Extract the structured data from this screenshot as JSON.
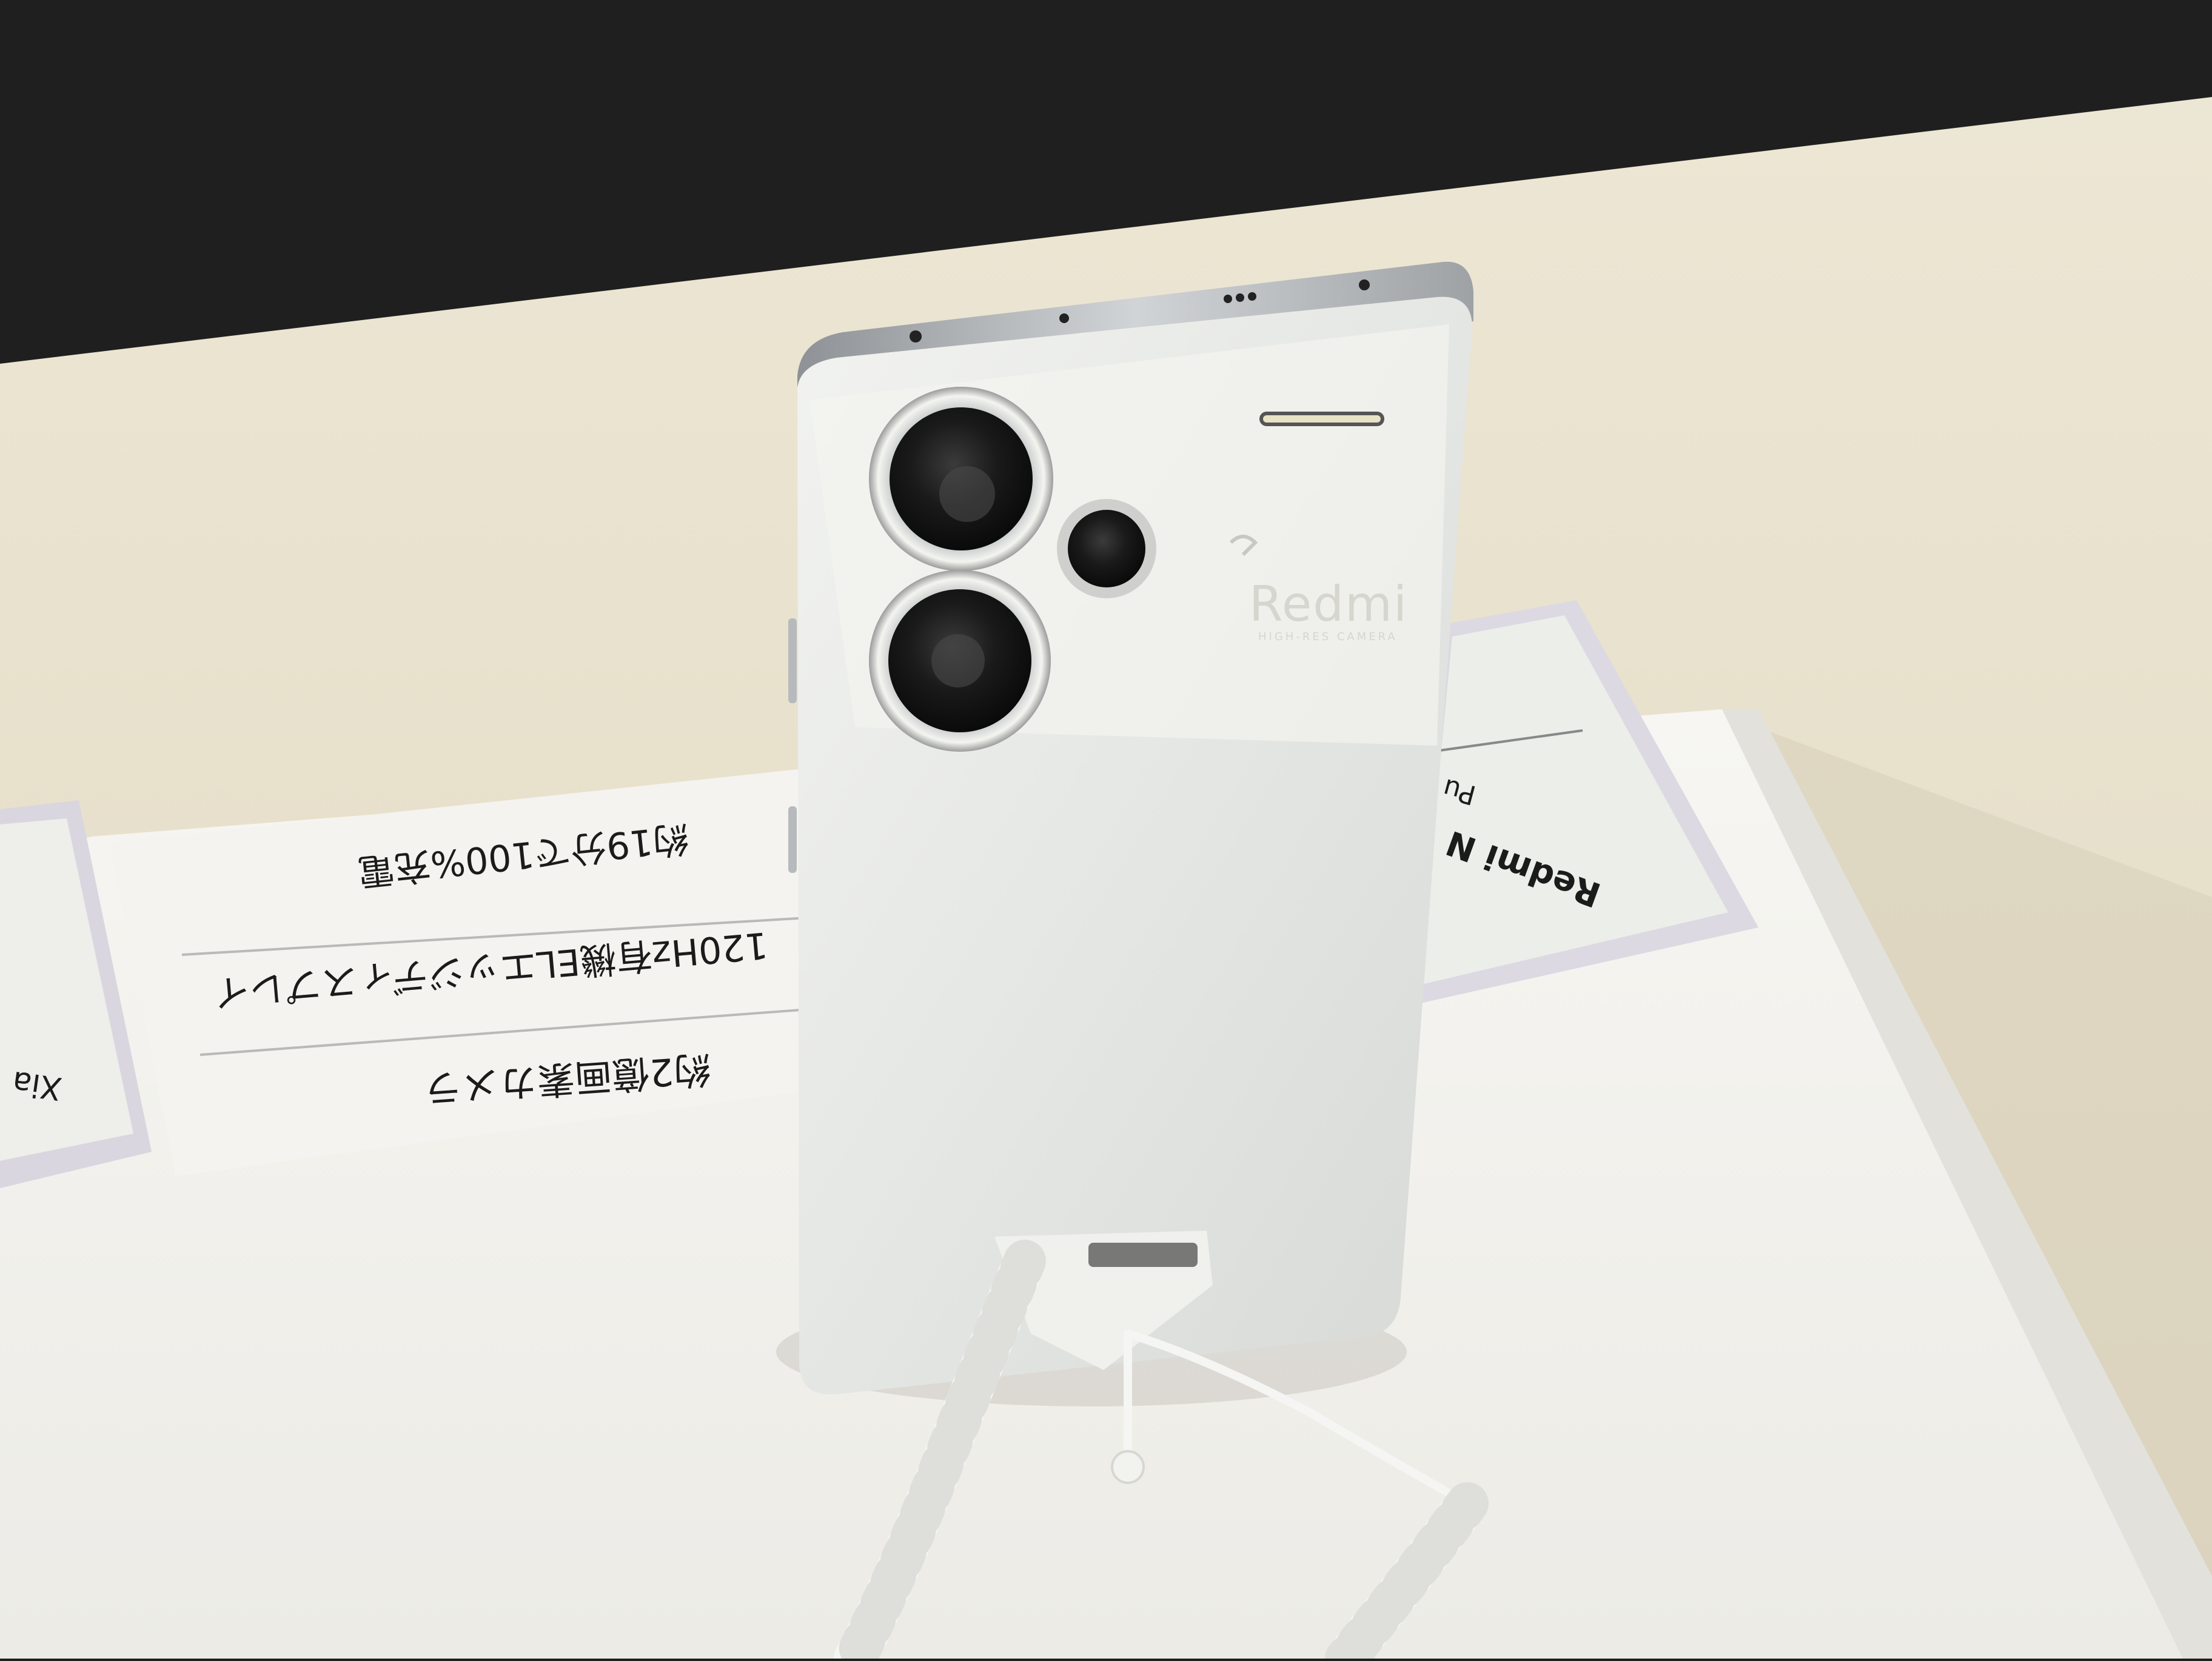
{
  "scene": {
    "description_colors": {
      "wall": "#1f1f1f",
      "table_top": "#e6dfcd",
      "display_base": "#f1f0ec",
      "phone_back": "#e9ebe8",
      "phone_frame": "#b9bcbf",
      "camera_lens": "#151515",
      "cable": "#f5f5f3"
    }
  },
  "front_sign": {
    "lines": [
      "約19分で100%充電",
      "120Hz有機ELエッジディスプレイ",
      "約2億画素カメラ"
    ]
  },
  "right_tag": {
    "title": "Redmi N",
    "sub": "Pu"
  },
  "left_tag": {
    "title": "Xia"
  },
  "phone": {
    "brand": "Redmi",
    "camera_caption": "HIGH-RES CAMERA"
  }
}
